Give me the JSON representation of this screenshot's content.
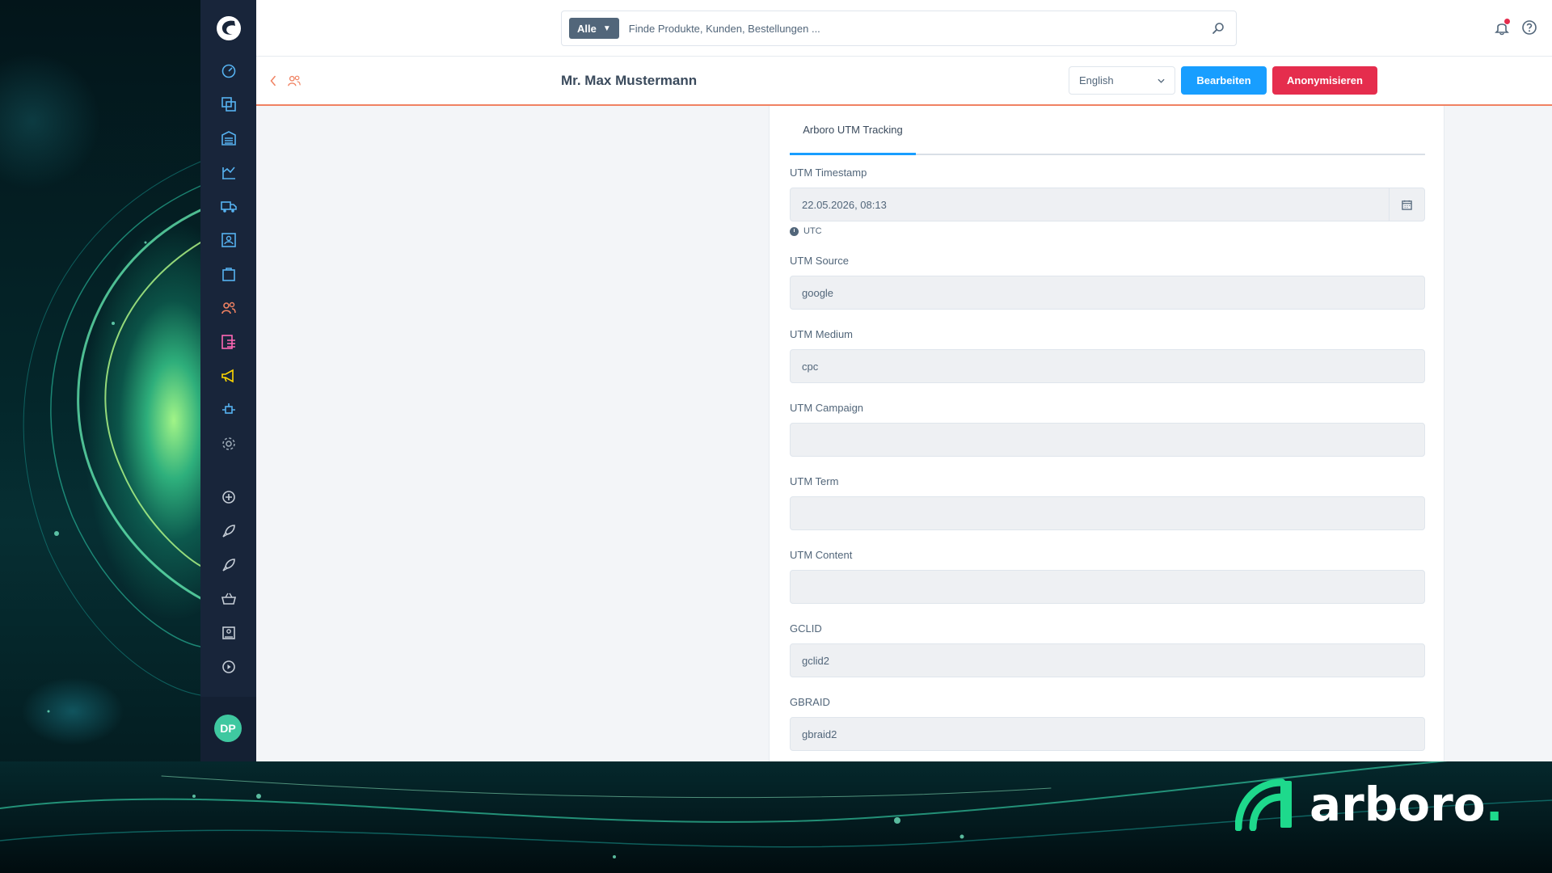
{
  "brand": {
    "name": "arboro",
    "dot": "."
  },
  "search": {
    "type_label": "Alle",
    "placeholder": "Finde Produkte, Kunden, Bestellungen ..."
  },
  "sidebar": {
    "items": [
      {
        "icon": "dashboard-icon",
        "color": "#56b2f0"
      },
      {
        "icon": "catalogue-icon",
        "color": "#56b2f0"
      },
      {
        "icon": "warehouse-icon",
        "color": "#56b2f0"
      },
      {
        "icon": "production-icon",
        "color": "#56b2f0"
      },
      {
        "icon": "delivery-truck-icon",
        "color": "#56b2f0"
      },
      {
        "icon": "customer-card-icon",
        "color": "#56b2f0"
      },
      {
        "icon": "orders-bag-icon",
        "color": "#56b2f0"
      },
      {
        "icon": "customers-icon",
        "color": "#f08262"
      },
      {
        "icon": "content-icon",
        "color": "#ff68b4"
      },
      {
        "icon": "marketing-megaphone-icon",
        "color": "#ffd700"
      },
      {
        "icon": "extensions-plug-icon",
        "color": "#56b2f0"
      },
      {
        "icon": "settings-gear-icon",
        "color": "#9aa8b5"
      },
      {
        "icon": "add-circle-icon",
        "color": "#c5cdd6"
      },
      {
        "icon": "rocket-icon",
        "color": "#c5cdd6"
      },
      {
        "icon": "rocket-2-icon",
        "color": "#c5cdd6"
      },
      {
        "icon": "basket-icon",
        "color": "#c5cdd6"
      },
      {
        "icon": "store-icon",
        "color": "#c5cdd6"
      },
      {
        "icon": "play-circle-icon",
        "color": "#c5cdd6"
      }
    ],
    "avatar_initials": "DP"
  },
  "smartbar": {
    "title": "Mr. Max Mustermann",
    "language": "English",
    "edit_label": "Bearbeiten",
    "anonymize_label": "Anonymisieren"
  },
  "tabs": [
    {
      "label": "Arboro UTM Tracking",
      "active": true
    }
  ],
  "fields": {
    "timestamp": {
      "label": "UTM Timestamp",
      "value": "22.05.2026, 08:13",
      "timezone": "UTC"
    },
    "source": {
      "label": "UTM Source",
      "value": "google"
    },
    "medium": {
      "label": "UTM Medium",
      "value": "cpc"
    },
    "campaign": {
      "label": "UTM Campaign",
      "value": ""
    },
    "term": {
      "label": "UTM Term",
      "value": ""
    },
    "content": {
      "label": "UTM Content",
      "value": ""
    },
    "gclid": {
      "label": "GCLID",
      "value": "gclid2"
    },
    "gbraid": {
      "label": "GBRAID",
      "value": "gbraid2"
    }
  },
  "colors": {
    "primary": "#189eff",
    "danger": "#e52d4d",
    "accent_customers": "#f08262",
    "brand_green": "#1ed98c",
    "sidebar_bg": "#18253a"
  }
}
